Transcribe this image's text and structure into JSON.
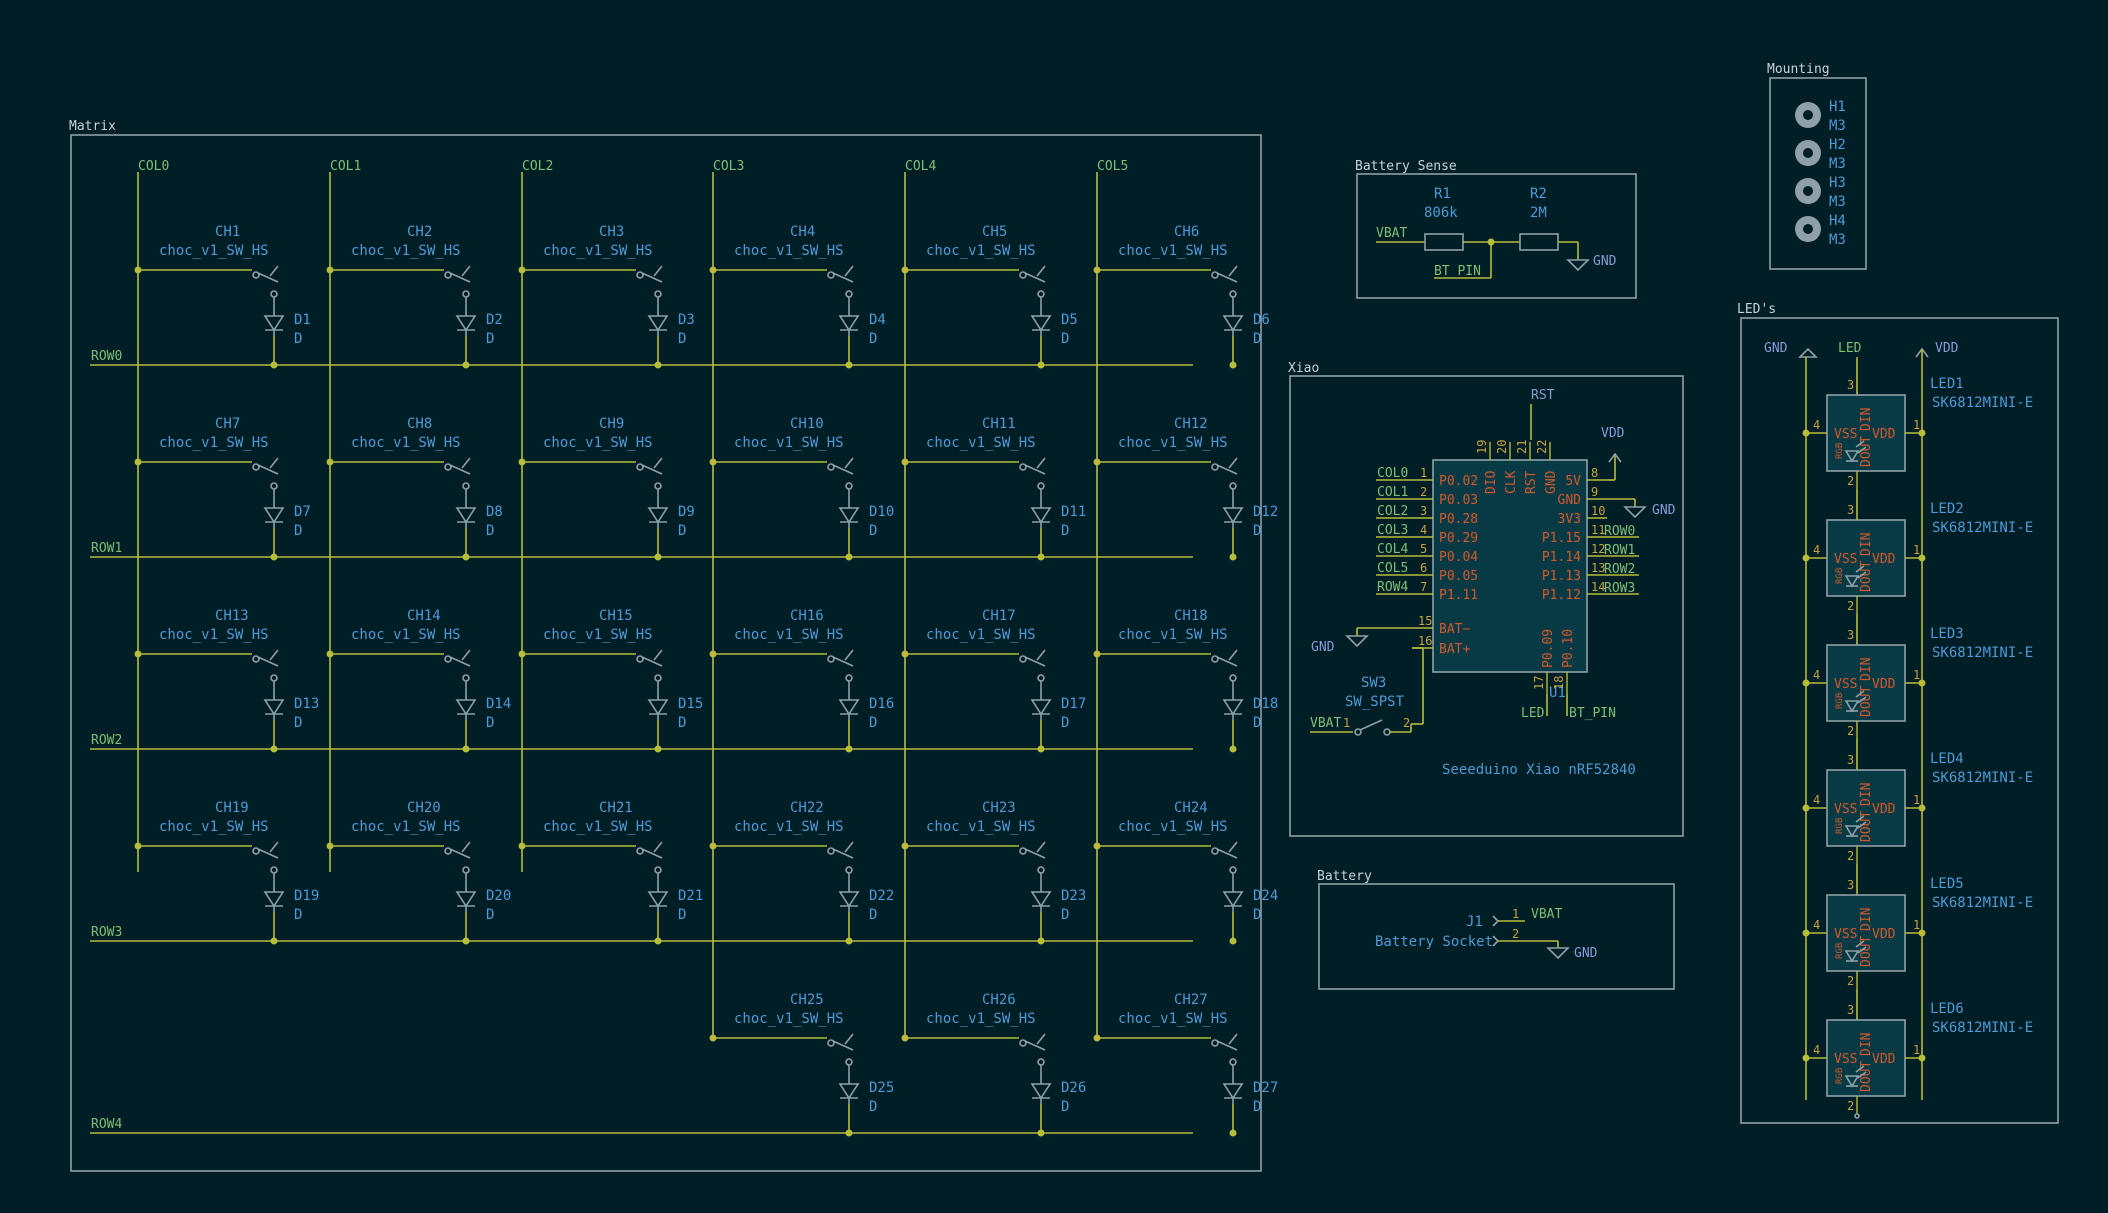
{
  "matrix": {
    "title": "Matrix",
    "columns": [
      "COL0",
      "COL1",
      "COL2",
      "COL3",
      "COL4",
      "COL5"
    ],
    "rows": [
      "ROW0",
      "ROW1",
      "ROW2",
      "ROW3",
      "ROW4"
    ],
    "switch_value": "choc_v1_SW_HS",
    "diode_value": "D",
    "switches": [
      {
        "ref": "CH1",
        "diode": "D1",
        "col": 0,
        "row": 0
      },
      {
        "ref": "CH2",
        "diode": "D2",
        "col": 1,
        "row": 0
      },
      {
        "ref": "CH3",
        "diode": "D3",
        "col": 2,
        "row": 0
      },
      {
        "ref": "CH4",
        "diode": "D4",
        "col": 3,
        "row": 0
      },
      {
        "ref": "CH5",
        "diode": "D5",
        "col": 4,
        "row": 0
      },
      {
        "ref": "CH6",
        "diode": "D6",
        "col": 5,
        "row": 0
      },
      {
        "ref": "CH7",
        "diode": "D7",
        "col": 0,
        "row": 1
      },
      {
        "ref": "CH8",
        "diode": "D8",
        "col": 1,
        "row": 1
      },
      {
        "ref": "CH9",
        "diode": "D9",
        "col": 2,
        "row": 1
      },
      {
        "ref": "CH10",
        "diode": "D10",
        "col": 3,
        "row": 1
      },
      {
        "ref": "CH11",
        "diode": "D11",
        "col": 4,
        "row": 1
      },
      {
        "ref": "CH12",
        "diode": "D12",
        "col": 5,
        "row": 1
      },
      {
        "ref": "CH13",
        "diode": "D13",
        "col": 0,
        "row": 2
      },
      {
        "ref": "CH14",
        "diode": "D14",
        "col": 1,
        "row": 2
      },
      {
        "ref": "CH15",
        "diode": "D15",
        "col": 2,
        "row": 2
      },
      {
        "ref": "CH16",
        "diode": "D16",
        "col": 3,
        "row": 2
      },
      {
        "ref": "CH17",
        "diode": "D17",
        "col": 4,
        "row": 2
      },
      {
        "ref": "CH18",
        "diode": "D18",
        "col": 5,
        "row": 2
      },
      {
        "ref": "CH19",
        "diode": "D19",
        "col": 0,
        "row": 3
      },
      {
        "ref": "CH20",
        "diode": "D20",
        "col": 1,
        "row": 3
      },
      {
        "ref": "CH21",
        "diode": "D21",
        "col": 2,
        "row": 3
      },
      {
        "ref": "CH22",
        "diode": "D22",
        "col": 3,
        "row": 3
      },
      {
        "ref": "CH23",
        "diode": "D23",
        "col": 4,
        "row": 3
      },
      {
        "ref": "CH24",
        "diode": "D24",
        "col": 5,
        "row": 3
      },
      {
        "ref": "CH25",
        "diode": "D25",
        "col": 3,
        "row": 4
      },
      {
        "ref": "CH26",
        "diode": "D26",
        "col": 4,
        "row": 4
      },
      {
        "ref": "CH27",
        "diode": "D27",
        "col": 5,
        "row": 4
      }
    ]
  },
  "battery_sense": {
    "title": "Battery Sense",
    "r1_ref": "R1",
    "r1_value": "806k",
    "r2_ref": "R2",
    "r2_value": "2M",
    "net_in": "VBAT",
    "net_out": "BT_PIN",
    "gnd": "GND"
  },
  "mounting": {
    "title": "Mounting",
    "holes": [
      {
        "ref": "H1",
        "value": "M3"
      },
      {
        "ref": "H2",
        "value": "M3"
      },
      {
        "ref": "H3",
        "value": "M3"
      },
      {
        "ref": "H4",
        "value": "M3"
      }
    ]
  },
  "xiao": {
    "title": "Xiao",
    "ref": "U1",
    "value": "Seeeduino Xiao nRF52840",
    "top_net": "RST",
    "vdd": "VDD",
    "gnd": "GND",
    "top_pins": [
      {
        "num": "19",
        "name": "DIO"
      },
      {
        "num": "20",
        "name": "CLK"
      },
      {
        "num": "21",
        "name": "RST"
      },
      {
        "num": "22",
        "name": "GND"
      }
    ],
    "left_pins": [
      {
        "num": "1",
        "name": "P0.02",
        "net": "COL0"
      },
      {
        "num": "2",
        "name": "P0.03",
        "net": "COL1"
      },
      {
        "num": "3",
        "name": "P0.28",
        "net": "COL2"
      },
      {
        "num": "4",
        "name": "P0.29",
        "net": "COL3"
      },
      {
        "num": "5",
        "name": "P0.04",
        "net": "COL4"
      },
      {
        "num": "6",
        "name": "P0.05",
        "net": "COL5"
      },
      {
        "num": "7",
        "name": "P1.11",
        "net": "ROW4"
      }
    ],
    "right_pins": [
      {
        "num": "8",
        "name": "5V",
        "net": ""
      },
      {
        "num": "9",
        "name": "GND",
        "net": ""
      },
      {
        "num": "10",
        "name": "3V3",
        "net": ""
      },
      {
        "num": "11",
        "name": "P1.15",
        "net": "ROW0"
      },
      {
        "num": "12",
        "name": "P1.14",
        "net": "ROW1"
      },
      {
        "num": "13",
        "name": "P1.13",
        "net": "ROW2"
      },
      {
        "num": "14",
        "name": "P1.12",
        "net": "ROW3"
      }
    ],
    "bat_pins": [
      {
        "num": "15",
        "name": "BAT−"
      },
      {
        "num": "16",
        "name": "BAT+"
      }
    ],
    "bottom_pins": [
      {
        "num": "17",
        "name": "P0.09",
        "net": "LED"
      },
      {
        "num": "18",
        "name": "P0.10",
        "net": "BT_PIN"
      }
    ],
    "switch_ref": "SW3",
    "switch_value": "SW_SPST",
    "switch_net": "VBAT",
    "switch_pin1": "1",
    "switch_pin2": "2"
  },
  "battery": {
    "title": "Battery",
    "ref": "J1",
    "value": "Battery Socket",
    "pin1": "1",
    "pin2": "2",
    "net1": "VBAT",
    "gnd": "GND"
  },
  "leds": {
    "title": "LED's",
    "gnd": "GND",
    "data": "LED",
    "vdd": "VDD",
    "value": "SK6812MINI-E",
    "refs": [
      "LED1",
      "LED2",
      "LED3",
      "LED4",
      "LED5",
      "LED6"
    ],
    "pin_labels": {
      "vss": "VSS",
      "vdd": "VDD",
      "dout": "DOUT",
      "din": "DIN",
      "rgb": "RGB"
    },
    "pin_nums": {
      "vss": "4",
      "vdd": "1",
      "dout": "2",
      "din": "3"
    }
  }
}
